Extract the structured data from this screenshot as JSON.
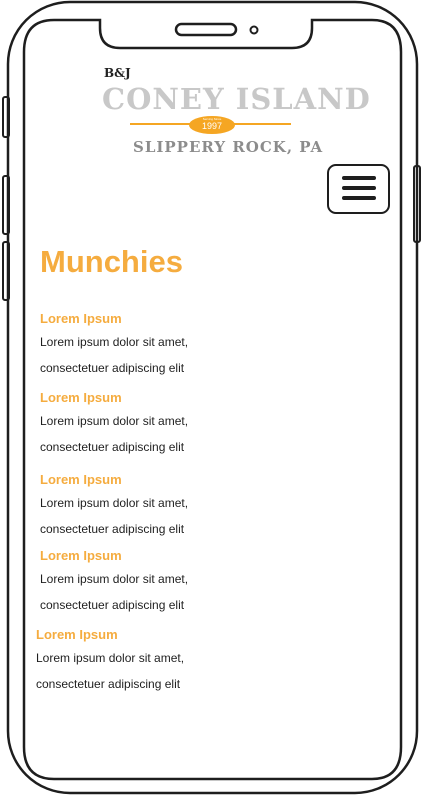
{
  "logo": {
    "brand": "B&J",
    "name": "CONEY ISLAND",
    "tagline": "Serving Since",
    "year": "1997",
    "location": "SLIPPERY ROCK, PA"
  },
  "page": {
    "title": "Munchies"
  },
  "menu_items": [
    {
      "name": "Lorem Ipsum",
      "line1": "Lorem ipsum dolor sit amet,",
      "line2": "consectetuer adipiscing elit"
    },
    {
      "name": "Lorem Ipsum",
      "line1": "Lorem ipsum dolor sit amet,",
      "line2": "consectetuer adipiscing elit"
    },
    {
      "name": "Lorem Ipsum",
      "line1": "Lorem ipsum dolor sit amet,",
      "line2": "consectetuer adipiscing elit"
    },
    {
      "name": "Lorem Ipsum",
      "line1": "Lorem ipsum dolor sit amet,",
      "line2": "consectetuer adipiscing elit"
    },
    {
      "name": "Lorem Ipsum",
      "line1": "Lorem ipsum dolor sit amet,",
      "line2": "consectetuer adipiscing elit"
    }
  ],
  "colors": {
    "accent": "#f5ac3f",
    "logo_gray": "#c8c8c8",
    "frame": "#1e1e1e"
  }
}
